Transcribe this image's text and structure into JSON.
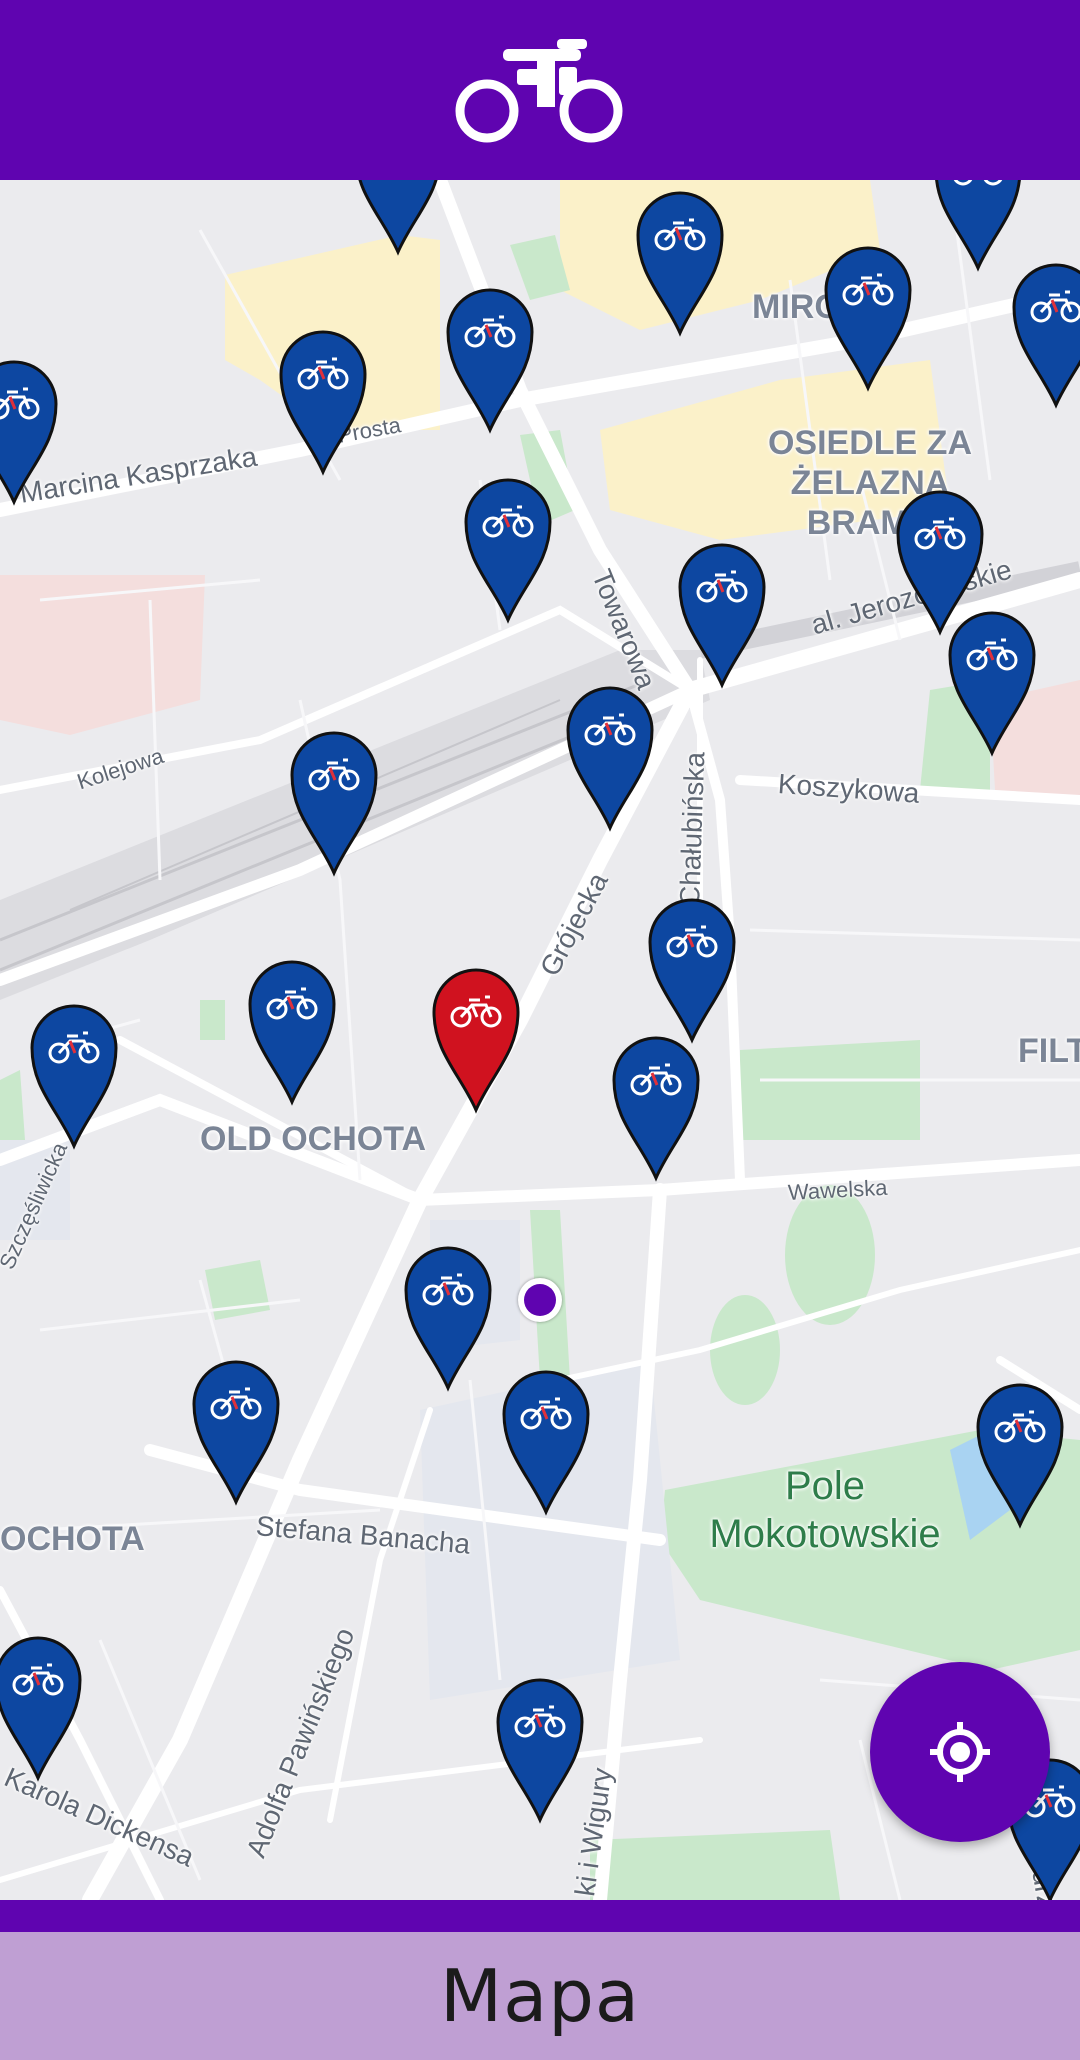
{
  "app_bar": {
    "icon": "bicycle-icon",
    "color": "#5f04b0"
  },
  "map": {
    "street_labels": [
      "Marcina Kasprzaka",
      "Prosta",
      "Towarowa",
      "al. Jerozolimskie",
      "Kolejowa",
      "Koszykowa",
      "Grójecka",
      "Chałubińska",
      "Wawelska",
      "Szczęśliwicka",
      "Stefana Banacha",
      "Adolfa Pawińskiego",
      "Karola Dickensa",
      "ki i Wigury",
      "Andrzej"
    ],
    "district_labels": [
      "MIRÓ",
      "OSIEDLE ZA ŻELAZNĄ BRAMĄ",
      "OLD OCHOTA",
      "OCHOTA",
      "FILT"
    ],
    "park_label": "Pole Mokotowskie",
    "station_pin_color": "#0d47a1",
    "selected_pin_color": "#d0121f",
    "pin_icon": "bicycle-icon",
    "user_location_color": "#5f04b0"
  },
  "fab": {
    "icon": "my-location-icon"
  },
  "bottom_nav": {
    "label": "Mapa",
    "background": "#bf9fd3"
  }
}
